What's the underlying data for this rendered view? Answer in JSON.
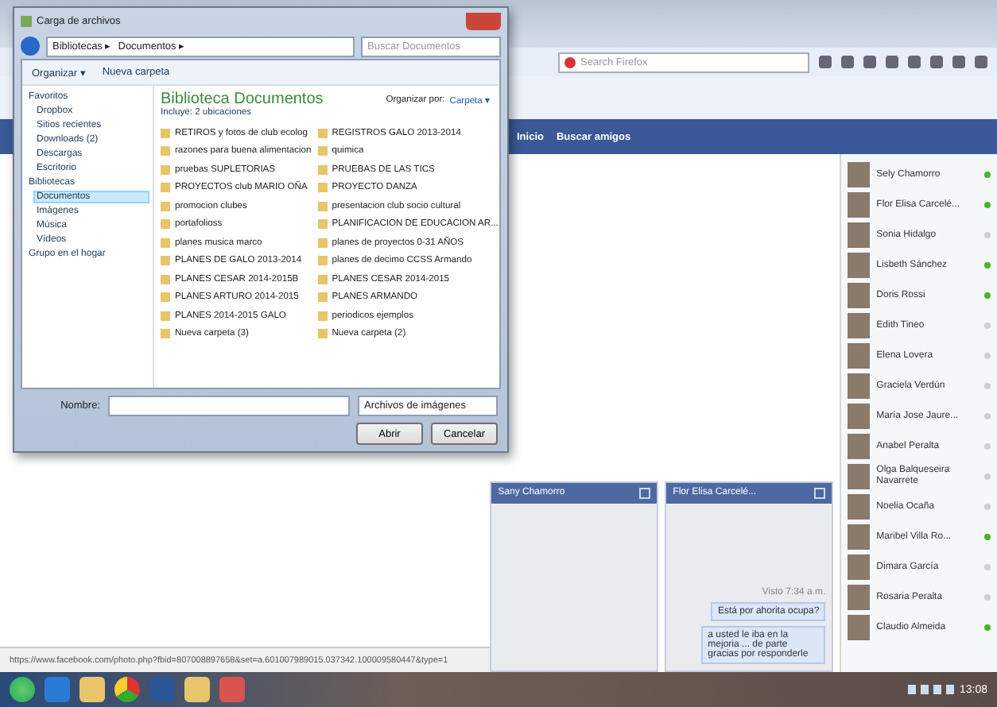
{
  "browser": {
    "search_placeholder": "Search Firefox",
    "nav_links": [
      "Inicio",
      "Buscar amigos"
    ],
    "status_url": "https://www.facebook.com/photo.php?fbid=807008897658&set=a.601007989015.037342.100009580447&type=1"
  },
  "dialog": {
    "title": "Carga de archivos",
    "breadcrumb": [
      "Bibliotecas ▸",
      "Documentos ▸"
    ],
    "search_placeholder": "Buscar Documentos",
    "toolbar": [
      "Organizar ▾",
      "Nueva carpeta"
    ],
    "nav": [
      {
        "label": "Favoritos",
        "selected": false,
        "children": [
          {
            "label": "Dropbox",
            "selected": false
          },
          {
            "label": "Sitios recientes",
            "selected": false
          },
          {
            "label": "Downloads (2)",
            "selected": false
          },
          {
            "label": "Descargas",
            "selected": false
          },
          {
            "label": "Escritorio",
            "selected": false
          }
        ]
      },
      {
        "label": "Bibliotecas",
        "selected": false,
        "children": [
          {
            "label": "Documentos",
            "selected": true
          },
          {
            "label": "Imágenes",
            "selected": false
          },
          {
            "label": "Música",
            "selected": false
          },
          {
            "label": "Vídeos",
            "selected": false
          }
        ]
      },
      {
        "label": "Grupo en el hogar",
        "selected": false
      }
    ],
    "library_title": "Biblioteca Documentos",
    "library_sub": "Incluye: 2 ubicaciones",
    "arrange_label": "Organizar por:",
    "arrange_value": "Carpeta ▾",
    "files": [
      [
        "RETIROS y fotos de club ecolog",
        "razones para buena alimentacion",
        "pruebas SUPLETORIAS",
        "PROYECTOS club MARIO OÑA",
        "promocion clubes",
        "portafolioss",
        "planes musica marco",
        "PLANES DE GALO 2013-2014",
        "PLANES CESAR 2014-2015B",
        "PLANES ARTURO 2014-2015",
        "PLANES 2014-2015 GALO",
        "Nueva carpeta (3)"
      ],
      [
        "REGISTROS GALO 2013-2014",
        "quimica",
        "PRUEBAS DE LAS TICS",
        "PROYECTO DANZA",
        "presentacion club socio cultural",
        "PLANIFICACION DE EDUCACION AR...",
        "planes de proyectos 0-31 AÑOS",
        "planes de decimo CCSS Armando",
        "PLANES CESAR 2014-2015",
        "PLANES ARMANDO",
        "periodicos ejemplos",
        "Nueva carpeta (2)"
      ]
    ],
    "name_label": "Nombre:",
    "file_type": "Archivos de imágenes",
    "open_button": "Abrir",
    "cancel_button": "Cancelar"
  },
  "chats": [
    {
      "name": "Sany Chamorro"
    },
    {
      "name": "Flor Elisa Carcelé...",
      "seen": "Visto 7:34 a.m.",
      "messages": [
        "Está por ahorita ocupa?",
        "a usted le iba en la mejoria ... de parte gracias por responderle"
      ]
    }
  ],
  "contacts": [
    {
      "name": "Sely Chamorro",
      "online": true
    },
    {
      "name": "Flor Elisa Carcelé...",
      "online": true
    },
    {
      "name": "Sonia Hidalgo",
      "online": false
    },
    {
      "name": "Lisbeth Sánchez",
      "online": true
    },
    {
      "name": "Doris Rossi",
      "online": true
    },
    {
      "name": "Edith Tineo",
      "online": false
    },
    {
      "name": "Elena Lovera",
      "online": false
    },
    {
      "name": "Graciela Verdún",
      "online": false
    },
    {
      "name": "María Jose Jaure...",
      "online": false
    },
    {
      "name": "Anabel Peralta",
      "online": false
    },
    {
      "name": "Olga Balqueseira Navarrete",
      "online": false
    },
    {
      "name": "Noelia Ocaña",
      "online": false
    },
    {
      "name": "Maribel Villa Ro...",
      "online": true
    },
    {
      "name": "Dimara García",
      "online": false
    },
    {
      "name": "Rosaria Peralta",
      "online": false
    },
    {
      "name": "Claudio Almeida",
      "online": true
    }
  ],
  "taskbar": {
    "time": "13:08"
  }
}
